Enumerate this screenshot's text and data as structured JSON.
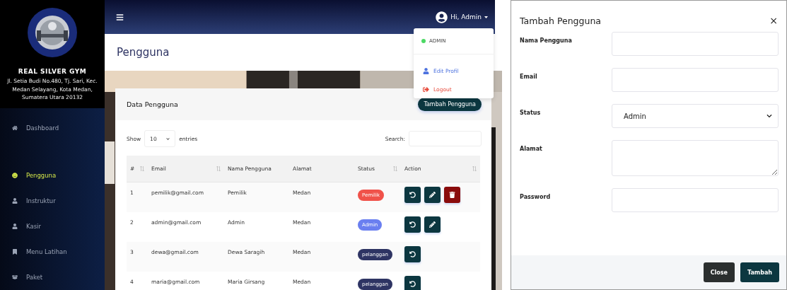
{
  "sidebar": {
    "brand": "REAL SILVER GYM",
    "address": "Jl. Setia Budi No.480, Tj. Sari, Kec. Medan Selayang, Kota Medan, Sumatera Utara 20132",
    "items": [
      {
        "label": "Dashboard",
        "kind": "home",
        "selected": false
      },
      {
        "label": "Pengguna",
        "kind": "users",
        "selected": true
      },
      {
        "label": "Instruktur",
        "kind": "user",
        "selected": false
      },
      {
        "label": "Kasir",
        "kind": "user",
        "selected": false
      },
      {
        "label": "Menu Latihan",
        "kind": "bookmark",
        "selected": false
      },
      {
        "label": "Paket",
        "kind": "box",
        "selected": false
      }
    ]
  },
  "header": {
    "greeting": "Hi, Admin"
  },
  "user_menu": {
    "role": "ADMIN",
    "items": [
      {
        "label": "Edit Profil",
        "kind": "profile",
        "color": "#4e73df"
      },
      {
        "label": "Logout",
        "kind": "logout",
        "color": "#e74a3b"
      }
    ]
  },
  "page_title": "Pengguna",
  "card": {
    "title": "Data Pengguna",
    "add_button": "Tambah Pengguna",
    "show_label": "Show",
    "page_size": "10",
    "entries_label": "entries",
    "search_label": "Search:",
    "columns": [
      {
        "label": "#",
        "sortable": true
      },
      {
        "label": "Email",
        "sortable": true
      },
      {
        "label": "Nama Pengguna",
        "sortable": false
      },
      {
        "label": "Alamat",
        "sortable": false
      },
      {
        "label": "Status",
        "sortable": true
      },
      {
        "label": "Action",
        "sortable": true
      }
    ],
    "rows": [
      {
        "no": "1",
        "email": "pemilik@gmail.com",
        "name": "Pemilik",
        "address": "Medan",
        "status": {
          "label": "Pemilik",
          "color": "#f0524a"
        },
        "actions": [
          {
            "kind": "reset"
          },
          {
            "kind": "edit"
          },
          {
            "kind": "delete"
          }
        ]
      },
      {
        "no": "2",
        "email": "admin@gmail.com",
        "name": "Admin",
        "address": "Medan",
        "status": {
          "label": "Admin",
          "color": "#6a7ff0"
        },
        "actions": [
          {
            "kind": "reset"
          },
          {
            "kind": "edit"
          }
        ]
      },
      {
        "no": "3",
        "email": "dewa@gmail.com",
        "name": "Dewa Saragih",
        "address": "Medan",
        "status": {
          "label": "pelanggan",
          "color": "#2e3463"
        },
        "actions": [
          {
            "kind": "reset"
          }
        ]
      },
      {
        "no": "4",
        "email": "maria@gmail.com",
        "name": "Maria Girsang",
        "address": "Medan",
        "status": {
          "label": "pelanggan",
          "color": "#2e3463"
        },
        "actions": [
          {
            "kind": "reset"
          }
        ]
      }
    ]
  },
  "modal": {
    "title": "Tambah Pengguna",
    "close": "×",
    "fields": [
      {
        "label": "Nama Pengguna",
        "kind": "text"
      },
      {
        "label": "Email",
        "kind": "text"
      },
      {
        "label": "Status",
        "kind": "select",
        "value": "Admin"
      },
      {
        "label": "Alamat",
        "kind": "textarea"
      },
      {
        "label": "Password",
        "kind": "password"
      }
    ],
    "buttons": [
      {
        "label": "Close",
        "kind": "secondary"
      },
      {
        "label": "Tambah",
        "kind": "primary"
      }
    ]
  }
}
